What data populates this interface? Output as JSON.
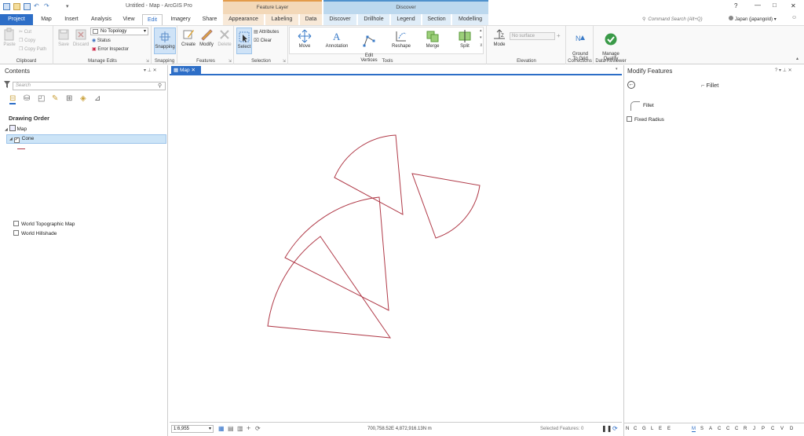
{
  "titlebar": {
    "title": "Untitled - Map - ArcGIS Pro",
    "help": "?",
    "min": "—",
    "max": "□",
    "close": "✕"
  },
  "context": {
    "feature_layer": "Feature Layer",
    "discover": "Discover"
  },
  "tabs": [
    "Project",
    "Map",
    "Insert",
    "Analysis",
    "View",
    "Edit",
    "Imagery",
    "Share",
    "Appearance",
    "Labeling",
    "Data",
    "Discover",
    "Drillhole",
    "Legend",
    "Section",
    "Modelling"
  ],
  "search": {
    "placeholder": "Command Search (Alt+Q)"
  },
  "user": "Japan (japangold)",
  "ribbon": {
    "clipboard": {
      "label": "Clipboard",
      "paste": "Paste",
      "cut": "Cut",
      "copy": "Copy",
      "copy_path": "Copy Path"
    },
    "manage_edits": {
      "label": "Manage Edits",
      "save": "Save",
      "discard": "Discard",
      "topology": "No Topology",
      "status": "Status",
      "error_inspector": "Error Inspector"
    },
    "snapping": {
      "label": "Snapping",
      "btn": "Snapping"
    },
    "features": {
      "label": "Features",
      "create": "Create",
      "modify": "Modify",
      "delete": "Delete"
    },
    "selection": {
      "label": "Selection",
      "select": "Select",
      "attributes": "Attributes",
      "clear": "Clear"
    },
    "tools": {
      "label": "Tools",
      "items": [
        "Move",
        "Annotation",
        "Edit\nVertices",
        "Reshape",
        "Merge",
        "Split"
      ]
    },
    "elevation": {
      "label": "Elevation",
      "mode": "Mode",
      "surface": "No surface"
    },
    "corrections": {
      "label": "Corrections",
      "ground": "Ground\nTo Grid"
    },
    "reviewer": {
      "label": "Data Reviewer",
      "manage": "Manage\nQuality"
    }
  },
  "contents": {
    "title": "Contents",
    "search_placeholder": "Search",
    "drawing_order": "Drawing Order",
    "map": "Map",
    "layers": [
      "Cone",
      "World Topographic Map",
      "World Hillshade"
    ]
  },
  "map_tab": "Map",
  "statusbar": {
    "scale": "1:6,955",
    "coords": "700,758.52E 4,872,916.13N m",
    "selected": "Selected Features: 0"
  },
  "modify": {
    "title": "Modify Features",
    "tool": "Fillet",
    "sub": "Fillet",
    "fixed_radius": "Fixed Radius",
    "letters": [
      "N",
      "C",
      "G",
      "L",
      "E",
      "E",
      "M",
      "S",
      "A",
      "C",
      "C",
      "C",
      "R",
      "J",
      "P",
      "C",
      "V",
      "D"
    ]
  },
  "colors": {
    "accent": "#2d6ec7",
    "ribbon_bg": "#f9f9f9",
    "feature_layer": "#f3d8b8",
    "discover": "#bcd8ee",
    "shape_stroke": "#b03a48",
    "selected_row": "#cce4f7"
  }
}
